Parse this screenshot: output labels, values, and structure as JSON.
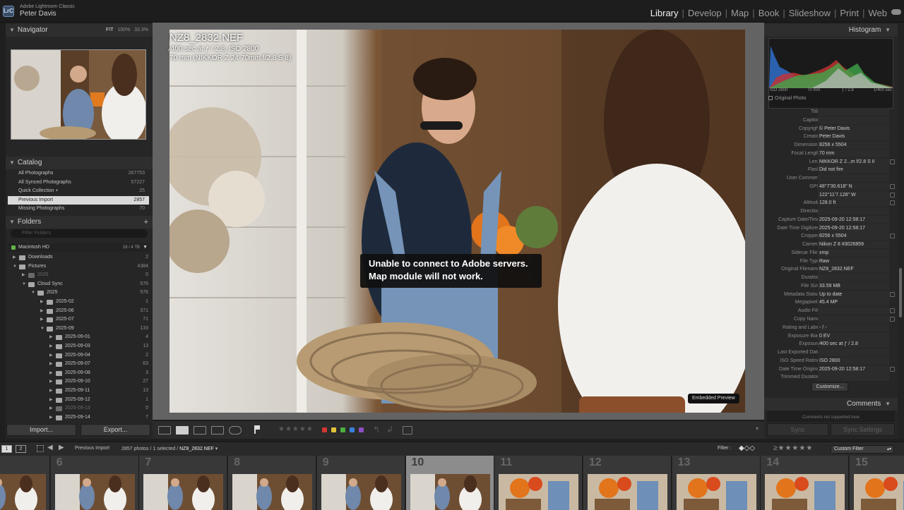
{
  "app": {
    "product": "Adobe Lightroom Classic",
    "logo": "LrC",
    "user": "Peter Davis"
  },
  "modules": [
    {
      "label": "Library",
      "active": true
    },
    {
      "label": "Develop",
      "active": false
    },
    {
      "label": "Map",
      "active": false
    },
    {
      "label": "Book",
      "active": false
    },
    {
      "label": "Slideshow",
      "active": false
    },
    {
      "label": "Print",
      "active": false
    },
    {
      "label": "Web",
      "active": false
    }
  ],
  "navigator": {
    "title": "Navigator",
    "zooms": [
      "FIT",
      "100%",
      "33.3%"
    ]
  },
  "catalog": {
    "title": "Catalog",
    "items": [
      {
        "label": "All Photographs",
        "count": "267753"
      },
      {
        "label": "All Synced Photographs",
        "count": "57227"
      },
      {
        "label": "Quick Collection +",
        "count": "25"
      },
      {
        "label": "Previous Import",
        "count": "2857",
        "selected": true
      },
      {
        "label": "Missing Photographs",
        "count": "70"
      }
    ]
  },
  "folders": {
    "title": "Folders",
    "add": "+",
    "search_placeholder": "Filter Folders",
    "volume": {
      "name": "Macintosh HD",
      "capacity": "19 / 4 TB"
    },
    "items": [
      {
        "label": "Downloads",
        "count": "2",
        "level": 0,
        "expand": "▶"
      },
      {
        "label": "Pictures",
        "count": "4384",
        "level": 0,
        "expand": "▼"
      },
      {
        "label": "2025",
        "count": "0",
        "level": 1,
        "expand": "▶",
        "dim": true
      },
      {
        "label": "Cloud Sync",
        "count": "576",
        "level": 1,
        "expand": "▼"
      },
      {
        "label": "2025",
        "count": "576",
        "level": 2,
        "expand": "▼"
      },
      {
        "label": "2025-02",
        "count": "1",
        "level": 3,
        "expand": "▶"
      },
      {
        "label": "2025-06",
        "count": "371",
        "level": 3,
        "expand": "▶"
      },
      {
        "label": "2025-07",
        "count": "71",
        "level": 3,
        "expand": "▶"
      },
      {
        "label": "2025-09",
        "count": "133",
        "level": 3,
        "expand": "▼"
      },
      {
        "label": "2025-09-01",
        "count": "4",
        "level": 4,
        "expand": "▶"
      },
      {
        "label": "2025-09-03",
        "count": "13",
        "level": 4,
        "expand": "▶"
      },
      {
        "label": "2025-09-04",
        "count": "2",
        "level": 4,
        "expand": "▶"
      },
      {
        "label": "2025-09-07",
        "count": "63",
        "level": 4,
        "expand": "▶"
      },
      {
        "label": "2025-09-08",
        "count": "3",
        "level": 4,
        "expand": "▶"
      },
      {
        "label": "2025-09-10",
        "count": "27",
        "level": 4,
        "expand": "▶"
      },
      {
        "label": "2025-09-11",
        "count": "13",
        "level": 4,
        "expand": "▶"
      },
      {
        "label": "2025-09-12",
        "count": "1",
        "level": 4,
        "expand": "▶"
      },
      {
        "label": "2025-09-13",
        "count": "0",
        "level": 4,
        "expand": "▶",
        "dim": true
      },
      {
        "label": "2025-09-14",
        "count": "7",
        "level": 4,
        "expand": "▶"
      }
    ]
  },
  "left_buttons": {
    "import": "Import...",
    "export": "Export..."
  },
  "photo": {
    "filename": "NZ8_2832.NEF",
    "exposure_line": "⁄400 sec at ƒ / 2.8, ISO 2800",
    "lens_line": "70 mm (NIKKOR Z 24-70mm f/2.8 S II)",
    "alert_line1": "Unable to connect to Adobe servers.",
    "alert_line2": "Map module will not work.",
    "badge": "Embedded Preview"
  },
  "histogram": {
    "title": "Histogram",
    "iso": "ISO 2800",
    "focal": "70 mm",
    "aperture": "ƒ / 2.8",
    "shutter": "1/400 sec",
    "original": "Original Photo"
  },
  "metadata": [
    {
      "k": "Title",
      "v": ""
    },
    {
      "k": "Caption",
      "v": ""
    },
    {
      "k": "Copyright",
      "v": "© Peter Davis"
    },
    {
      "k": "Creator",
      "v": "Peter Davis"
    },
    {
      "k": "Dimensions",
      "v": "8256 x 5504"
    },
    {
      "k": "Focal Length",
      "v": "70 mm"
    },
    {
      "k": "Lens",
      "v": "NIKKOR Z 2...m f/2.8 S II"
    },
    {
      "k": "Flash",
      "v": "Did not fire"
    },
    {
      "k": "User Comment",
      "v": ""
    },
    {
      "k": "GPS",
      "v": "48°7'30.618\" N"
    },
    {
      "k": "",
      "v": "122°11'7.128\" W"
    },
    {
      "k": "Altitude",
      "v": "128.0 ft"
    },
    {
      "k": "Direction",
      "v": ""
    },
    {
      "k": "Capture Date/Time",
      "v": "2025-09-20 12:58:17"
    },
    {
      "k": "Date Time Digitized",
      "v": "2025-09-20 12:58:17"
    },
    {
      "k": "Cropped",
      "v": "8256 x 5504"
    },
    {
      "k": "Camera",
      "v": "Nikon Z 8 #3026859"
    },
    {
      "k": "Sidecar Files",
      "v": "xmp"
    },
    {
      "k": "File Type",
      "v": "Raw"
    },
    {
      "k": "Original Filename",
      "v": "NZ8_2832.NEF"
    },
    {
      "k": "Duration",
      "v": ""
    },
    {
      "k": "File Size",
      "v": "33.59 MB"
    },
    {
      "k": "Metadata Status",
      "v": "Up to date"
    },
    {
      "k": "Megapixels",
      "v": "45.4 MP"
    },
    {
      "k": "Audio File",
      "v": ""
    },
    {
      "k": "Copy Name",
      "v": ""
    },
    {
      "k": "Rating and Label",
      "v": "- / -"
    },
    {
      "k": "Exposure Bias",
      "v": "0 EV"
    },
    {
      "k": "Exposure",
      "v": "⁄400 sec at ƒ / 2.8"
    },
    {
      "k": "Last Exported Date",
      "v": ""
    },
    {
      "k": "ISO Speed Rating",
      "v": "ISO 2800"
    },
    {
      "k": "Date Time Original",
      "v": "2025-09-20 12:58:17"
    },
    {
      "k": "Trimmed Duration",
      "v": ""
    }
  ],
  "customize": "Customize...",
  "comments": {
    "title": "Comments",
    "note": "Comments not supported here"
  },
  "sync": {
    "sync": "Sync",
    "settings": "Sync Settings"
  },
  "filmstrip_bar": {
    "screen1": "1",
    "screen2": "2",
    "source": "Previous Import",
    "count_text": "2857 photos / 1 selected / ",
    "file": "NZ8_2832.NEF",
    "filter_label": "Filter :",
    "filter_mode": "Custom Filter"
  },
  "filmstrip": {
    "numbers": [
      "",
      "6",
      "7",
      "8",
      "9",
      "10",
      "11",
      "12",
      "13",
      "14",
      "15"
    ],
    "selected": "10"
  },
  "colors": {
    "accent_select": "#d9d9d9",
    "panel": "#262626",
    "labels": [
      "#d2372f",
      "#e3c33a",
      "#4cae3f",
      "#3a7fd8",
      "#8d4fc4"
    ]
  }
}
